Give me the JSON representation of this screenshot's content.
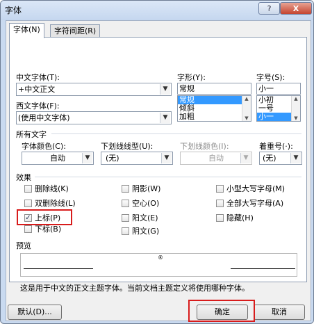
{
  "window": {
    "title": "字体",
    "help_label": "?",
    "close_label": "X"
  },
  "tabs": [
    {
      "label": "字体(N)"
    },
    {
      "label": "字符间距(R)"
    }
  ],
  "font": {
    "cn_font_label": "中文字体(T):",
    "cn_font_value": "+中文正文",
    "west_font_label": "西文字体(F):",
    "west_font_value": "(使用中文字体)",
    "style_label": "字形(Y):",
    "style_value": "常规",
    "style_options": [
      "常规",
      "倾斜",
      "加粗"
    ],
    "size_label": "字号(S):",
    "size_value": "小一",
    "size_options": [
      "小初",
      "一号",
      "小一"
    ]
  },
  "all_text": {
    "section_label": "所有文字",
    "font_color_label": "字体颜色(C):",
    "font_color_value": "自动",
    "underline_type_label": "下划线线型(U):",
    "underline_type_value": "(无)",
    "underline_color_label": "下划线颜色(I):",
    "underline_color_value": "自动",
    "emphasis_label": "着重号(·):",
    "emphasis_value": "(无)"
  },
  "effects": {
    "section_label": "效果",
    "items": [
      {
        "label": "删除线(K)",
        "checked": false
      },
      {
        "label": "双删除线(L)",
        "checked": false
      },
      {
        "label": "上标(P)",
        "checked": true
      },
      {
        "label": "下标(B)",
        "checked": false
      },
      {
        "label": "阴影(W)",
        "checked": false
      },
      {
        "label": "空心(O)",
        "checked": false
      },
      {
        "label": "阳文(E)",
        "checked": false
      },
      {
        "label": "阴文(G)",
        "checked": false
      },
      {
        "label": "小型大写字母(M)",
        "checked": false
      },
      {
        "label": "全部大写字母(A)",
        "checked": false
      },
      {
        "label": "隐藏(H)",
        "checked": false
      }
    ]
  },
  "preview": {
    "section_label": "预览",
    "sample_text": "®",
    "note": "这是用于中文的正文主题字体。当前文档主题定义将使用哪种字体。"
  },
  "buttons": {
    "default_label": "默认(D)...",
    "ok_label": "确定",
    "cancel_label": "取消"
  },
  "colors": {
    "highlight": "#d81c1c",
    "selection": "#3399ff",
    "frame": "#c9daf0"
  }
}
